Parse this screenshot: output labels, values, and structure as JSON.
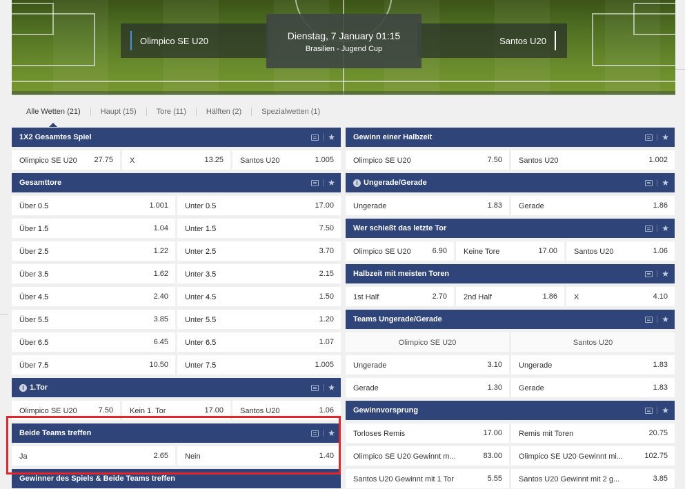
{
  "match": {
    "home": "Olimpico SE U20",
    "away": "Santos U20",
    "date": "Dienstag, 7 January 01:15",
    "league": "Brasilien - Jugend Cup"
  },
  "tabs": [
    "Alle Wetten (21)",
    "Haupt (15)",
    "Tore (11)",
    "Hälften (2)",
    "Spezialwetten (1)"
  ],
  "markets_left": {
    "m1x2": {
      "title": "1X2 Gesamtes Spiel",
      "cells": [
        {
          "label": "Olimpico SE U20",
          "odd": "27.75"
        },
        {
          "label": "X",
          "odd": "13.25"
        },
        {
          "label": "Santos U20",
          "odd": "1.005"
        }
      ]
    },
    "gesamttore": {
      "title": "Gesamttore",
      "rows": [
        {
          "o": "Über",
          "ov": "0.5",
          "oo": "1.001",
          "u": "Unter",
          "uv": "0.5",
          "uo": "17.00"
        },
        {
          "o": "Über",
          "ov": "1.5",
          "oo": "1.04",
          "u": "Unter",
          "uv": "1.5",
          "uo": "7.50"
        },
        {
          "o": "Über",
          "ov": "2.5",
          "oo": "1.22",
          "u": "Unter",
          "uv": "2.5",
          "uo": "3.70"
        },
        {
          "o": "Über",
          "ov": "3.5",
          "oo": "1.62",
          "u": "Unter",
          "uv": "3.5",
          "uo": "2.15"
        },
        {
          "o": "Über",
          "ov": "4.5",
          "oo": "2.40",
          "u": "Unter",
          "uv": "4.5",
          "uo": "1.50"
        },
        {
          "o": "Über",
          "ov": "5.5",
          "oo": "3.85",
          "u": "Unter",
          "uv": "5.5",
          "uo": "1.20"
        },
        {
          "o": "Über",
          "ov": "6.5",
          "oo": "6.45",
          "u": "Unter",
          "uv": "6.5",
          "uo": "1.07"
        },
        {
          "o": "Über",
          "ov": "7.5",
          "oo": "10.50",
          "u": "Unter",
          "uv": "7.5",
          "uo": "1.005"
        }
      ]
    },
    "erstesTor": {
      "title": "1.Tor",
      "cells": [
        {
          "label": "Olimpico SE U20",
          "odd": "7.50"
        },
        {
          "label": "Kein 1. Tor",
          "odd": "17.00"
        },
        {
          "label": "Santos U20",
          "odd": "1.06"
        }
      ]
    },
    "beideTeams": {
      "title": "Beide Teams treffen",
      "cells": [
        {
          "label": "Ja",
          "odd": "2.65"
        },
        {
          "label": "Nein",
          "odd": "1.40"
        }
      ]
    },
    "gewinnerBeide": {
      "title": "Gewinner des Spiels & Beide Teams treffen"
    }
  },
  "markets_right": {
    "gewinnHalbzeit": {
      "title": "Gewinn einer Halbzeit",
      "cells": [
        {
          "label": "Olimpico SE U20",
          "odd": "7.50"
        },
        {
          "label": "Santos U20",
          "odd": "1.002"
        }
      ]
    },
    "ungeradeGerade": {
      "title": "Ungerade/Gerade",
      "cells": [
        {
          "label": "Ungerade",
          "odd": "1.83"
        },
        {
          "label": "Gerade",
          "odd": "1.86"
        }
      ]
    },
    "letztesTor": {
      "title": "Wer schießt das letzte Tor",
      "cells": [
        {
          "label": "Olimpico SE U20",
          "odd": "6.90"
        },
        {
          "label": "Keine Tore",
          "odd": "17.00"
        },
        {
          "label": "Santos U20",
          "odd": "1.06"
        }
      ]
    },
    "halbzeitMeisten": {
      "title": "Halbzeit mit meisten Toren",
      "cells": [
        {
          "label": "1st Half",
          "odd": "2.70"
        },
        {
          "label": "2nd Half",
          "odd": "1.86"
        },
        {
          "label": "X",
          "odd": "4.10"
        }
      ]
    },
    "teamsUngerade": {
      "title": "Teams Ungerade/Gerade",
      "columns": [
        "Olimpico SE U20",
        "Santos U20"
      ],
      "rows": [
        [
          {
            "label": "Ungerade",
            "odd": "3.10"
          },
          {
            "label": "Ungerade",
            "odd": "1.83"
          }
        ],
        [
          {
            "label": "Gerade",
            "odd": "1.30"
          },
          {
            "label": "Gerade",
            "odd": "1.83"
          }
        ]
      ]
    },
    "gewinnvorsprung": {
      "title": "Gewinnvorsprung",
      "rows": [
        [
          {
            "label": "Torloses Remis",
            "odd": "17.00"
          },
          {
            "label": "Remis mit Toren",
            "odd": "20.75"
          }
        ],
        [
          {
            "label": "Olimpico SE U20 Gewinnt m...",
            "odd": "83.00"
          },
          {
            "label": "Olimpico SE U20 Gewinnt mi...",
            "odd": "102.75"
          }
        ],
        [
          {
            "label": "Santos U20 Gewinnt mit 1 Tor",
            "odd": "5.55"
          },
          {
            "label": "Santos U20 Gewinnt mit 2 g...",
            "odd": "3.85"
          }
        ]
      ]
    }
  },
  "colors": {
    "header": "#2f4479",
    "highlight": "#e3262b",
    "homeBar": "#4a90e2"
  },
  "icons": {
    "stats": "stats-icon",
    "favorite": "star-icon",
    "info": "info-icon"
  }
}
